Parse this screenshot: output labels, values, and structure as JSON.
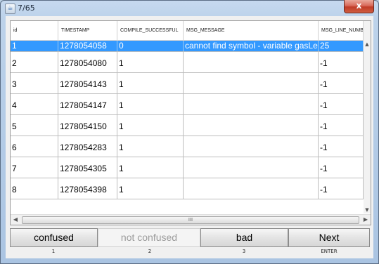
{
  "window": {
    "title": "7/65",
    "icon": "java-app-icon",
    "close_label": "x"
  },
  "table": {
    "columns": [
      "id",
      "TIMESTAMP",
      "COMPILE_SUCCESSFUL",
      "MSG_MESSAGE",
      "MSG_LINE_NUMBER"
    ],
    "rows": [
      {
        "id": "1",
        "timestamp": "1278054058",
        "compile": "0",
        "message": "cannot find symbol - variable gasLeft",
        "line": "25"
      },
      {
        "id": "2",
        "timestamp": "1278054080",
        "compile": "1",
        "message": "",
        "line": "-1"
      },
      {
        "id": "3",
        "timestamp": "1278054143",
        "compile": "1",
        "message": "",
        "line": "-1"
      },
      {
        "id": "4",
        "timestamp": "1278054147",
        "compile": "1",
        "message": "",
        "line": "-1"
      },
      {
        "id": "5",
        "timestamp": "1278054150",
        "compile": "1",
        "message": "",
        "line": "-1"
      },
      {
        "id": "6",
        "timestamp": "1278054283",
        "compile": "1",
        "message": "",
        "line": "-1"
      },
      {
        "id": "7",
        "timestamp": "1278054305",
        "compile": "1",
        "message": "",
        "line": "-1"
      },
      {
        "id": "8",
        "timestamp": "1278054398",
        "compile": "1",
        "message": "",
        "line": "-1"
      }
    ],
    "selected_row_index": 0,
    "hscroll_grip": "III"
  },
  "buttons": [
    {
      "label": "confused",
      "key": "1",
      "enabled": true
    },
    {
      "label": "not confused",
      "key": "2",
      "enabled": false
    },
    {
      "label": "bad",
      "key": "3",
      "enabled": true
    },
    {
      "label": "Next",
      "key": "ENTER",
      "enabled": true
    }
  ],
  "colors": {
    "selection": "#3399ff",
    "window_frame": "#bcd2ea"
  }
}
